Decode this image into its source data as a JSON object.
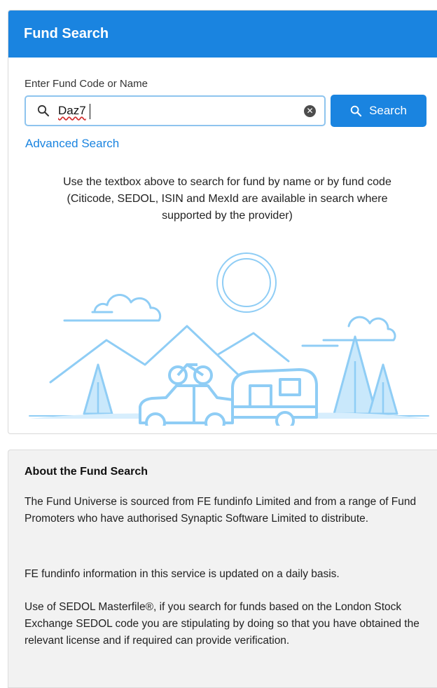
{
  "search_card": {
    "title": "Fund Search",
    "field_label": "Enter Fund Code or Name",
    "input_value": "Daz7",
    "search_button_label": "Search",
    "advanced_link": "Advanced Search",
    "help_line_1": "Use the textbox above to search for fund by name or by fund code",
    "help_line_2": "(Citicode, SEDOL, ISIN and MexId are available in search where",
    "help_line_3": "supported by the provider)",
    "icons": [
      "search-icon",
      "clear-icon",
      "search-icon"
    ]
  },
  "about": {
    "title": "About the Fund Search",
    "para_1": "The Fund Universe is sourced from FE fundinfo Limited and from a range of Fund Promoters who have authorised Synaptic Software Limited to distribute.",
    "para_2": "FE fundinfo information in this service is updated on a daily basis.",
    "para_3": "Use of SEDOL Masterfile®, if you search for funds based on the London Stock Exchange SEDOL code you are stipulating by doing so that you have obtained the relevant license and if required can provide verification."
  },
  "colors": {
    "primary": "#1a84e0",
    "illustration": "#8fcdf5",
    "about_bg": "#f2f2f2"
  }
}
